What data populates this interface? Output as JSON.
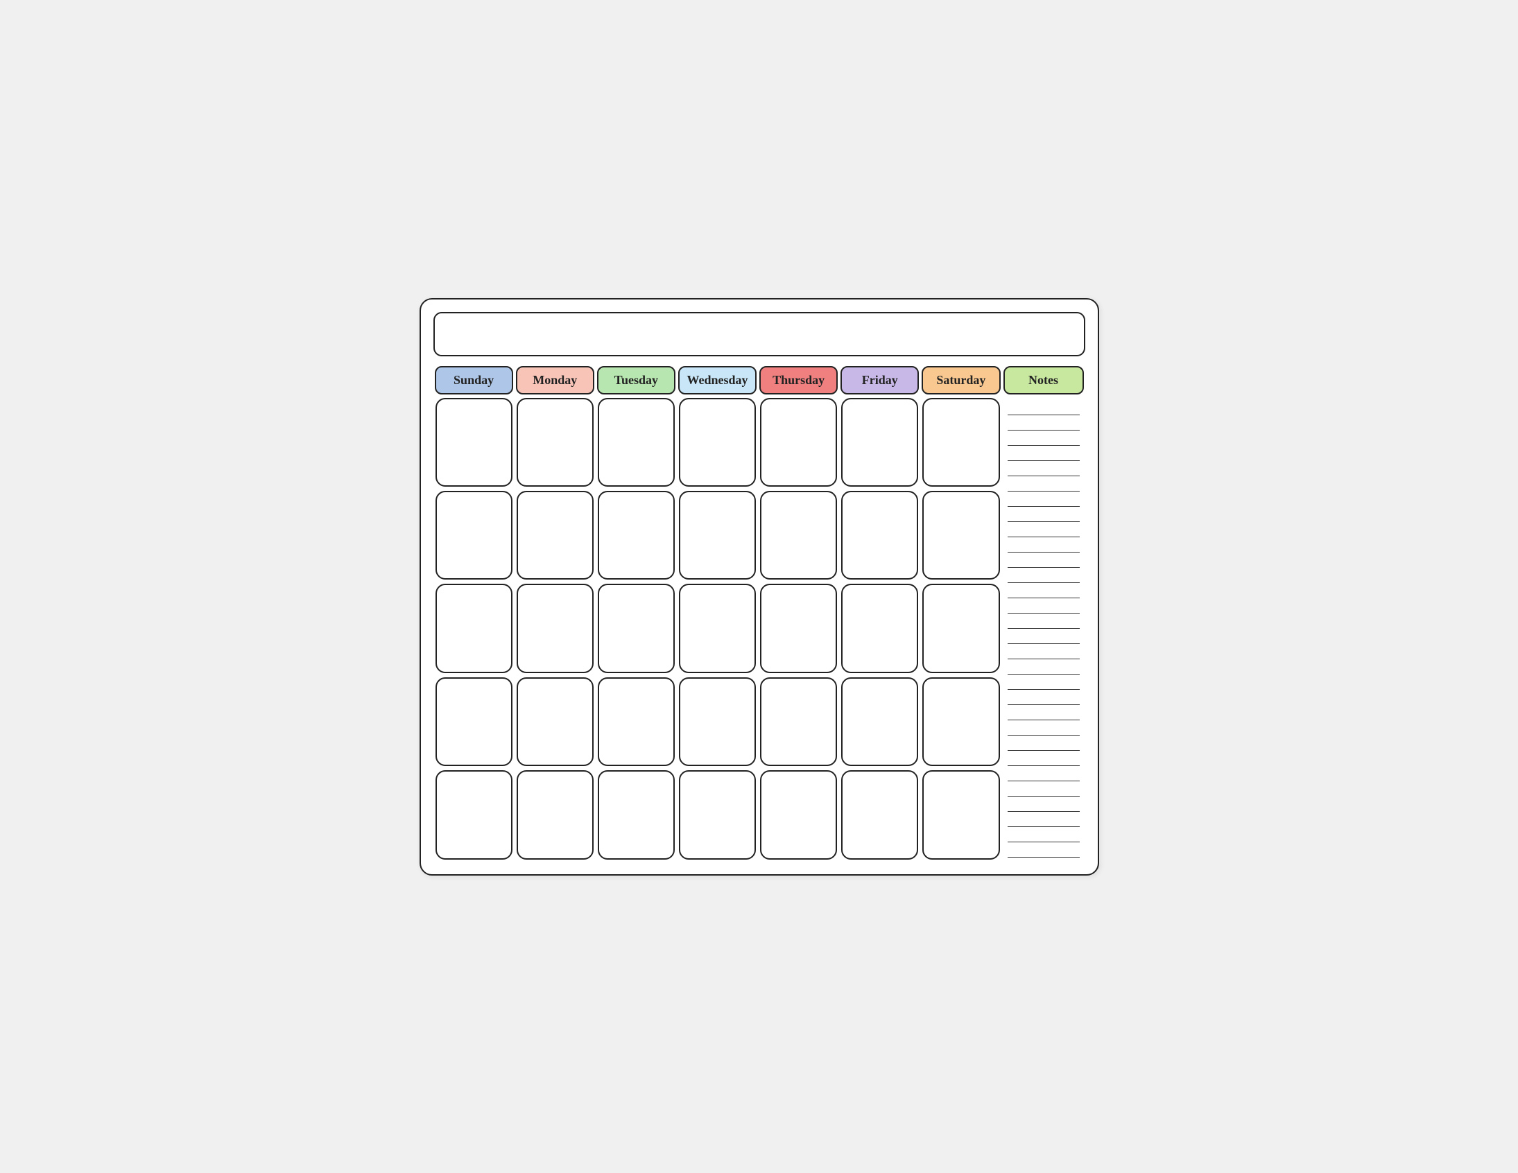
{
  "calendar": {
    "title": "",
    "days": [
      {
        "label": "Sunday",
        "color_class": "header-sunday"
      },
      {
        "label": "Monday",
        "color_class": "header-monday"
      },
      {
        "label": "Tuesday",
        "color_class": "header-tuesday"
      },
      {
        "label": "Wednesday",
        "color_class": "header-wednesday"
      },
      {
        "label": "Thursday",
        "color_class": "header-thursday"
      },
      {
        "label": "Friday",
        "color_class": "header-friday"
      },
      {
        "label": "Saturday",
        "color_class": "header-saturday"
      }
    ],
    "notes_label": "Notes",
    "num_rows": 5,
    "notes_lines": 30
  }
}
